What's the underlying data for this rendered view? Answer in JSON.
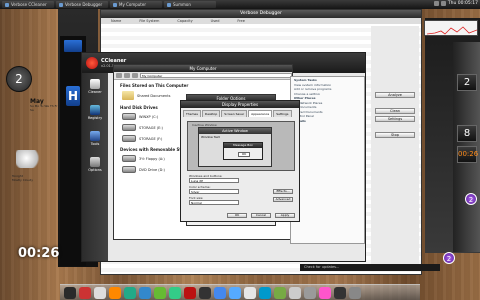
{
  "taskbar": {
    "tasks": [
      "Verbose CCleaner",
      "Verbose Debugger",
      "My Computer",
      "Summon"
    ],
    "clock": "Thu 00:05:17"
  },
  "gadgets": {
    "clock_hour": "2",
    "calendar_month": "May",
    "calendar_days": "Su Mo Tu We Th Fr Sa",
    "weather_lines": [
      "Tonight",
      "Mostly Cloudy"
    ],
    "big_clock": "00:26"
  },
  "dialog": {
    "title": "Verbose Debugger",
    "columns": [
      "Name",
      "File System",
      "Capacity",
      "Used",
      "Free"
    ],
    "side_buttons": [
      "Analyze",
      "Clean",
      "Settings",
      "Stop"
    ]
  },
  "ccleaner": {
    "name": "CCleaner",
    "version": "v2.01.525",
    "sidebar": [
      "Cleaner",
      "Registry",
      "Tools",
      "Options"
    ]
  },
  "mycomputer": {
    "title": "My Computer",
    "address": "My Computer",
    "sections": [
      "Files Stored on This Computer",
      "Hard Disk Drives",
      "Devices with Removable Storage"
    ],
    "items": [
      "Shared Documents",
      "WINXP (C:)",
      "STORAGE (E:)",
      "STORAGE (F:)",
      "3½ Floppy (A:)",
      "DVD Drive (D:)"
    ]
  },
  "folder_options": {
    "title": "Folder Options"
  },
  "system_tasks": {
    "lines": [
      "System Tasks",
      "View system information",
      "Add or remove programs",
      "Change a setting",
      "Other Places",
      "My Network Places",
      "My Documents",
      "Shared Documents",
      "Control Panel",
      "Details"
    ]
  },
  "display_props": {
    "title": "Display Properties",
    "tabs": [
      "Themes",
      "Desktop",
      "Screen Saver",
      "Appearance",
      "Settings"
    ],
    "preview_inactive": "Inactive Window",
    "preview_active": "Active Window",
    "message_box": "Message Box",
    "window_text": "Window Text",
    "ok": "OK",
    "label_windows": "Windows and buttons:",
    "value_windows": "Luna XP",
    "label_color": "Color scheme:",
    "value_color": "Silver",
    "label_font": "Font size:",
    "value_font": "Normal",
    "btn_effects": "Effects...",
    "btn_advanced": "Advanced",
    "btn_ok": "OK",
    "btn_cancel": "Cancel",
    "btn_apply": "Apply"
  },
  "right_tiles": [
    "2",
    "8",
    "00:26",
    "2"
  ],
  "statusbar": {
    "text": "Check for updates..."
  }
}
